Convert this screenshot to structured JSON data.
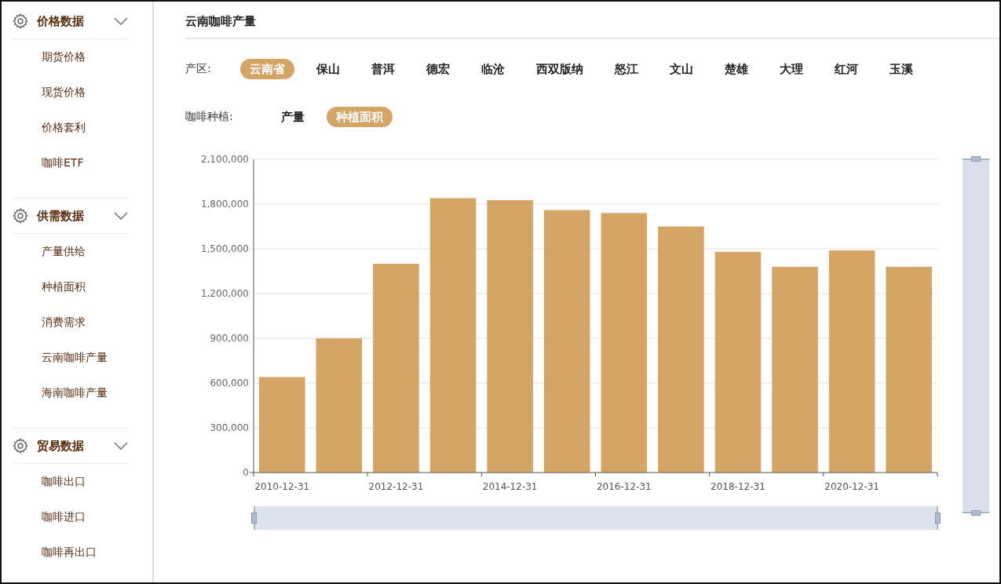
{
  "sidebar": {
    "sections": [
      {
        "title": "价格数据",
        "expanded": true,
        "items": [
          "期货价格",
          "现货价格",
          "价格套利",
          "咖啡ETF"
        ]
      },
      {
        "title": "供需数据",
        "expanded": true,
        "items": [
          "产量供给",
          "种植面积",
          "消费需求",
          "云南咖啡产量",
          "海南咖啡产量"
        ]
      },
      {
        "title": "贸易数据",
        "expanded": true,
        "items": [
          "咖啡出口",
          "咖啡进口",
          "咖啡再出口"
        ]
      }
    ]
  },
  "main": {
    "title": "云南咖啡产量",
    "filters": [
      {
        "label": "产区:",
        "options": [
          {
            "text": "云南省",
            "selected": true
          },
          {
            "text": "保山",
            "selected": false
          },
          {
            "text": "普洱",
            "selected": false
          },
          {
            "text": "德宏",
            "selected": false
          },
          {
            "text": "临沧",
            "selected": false
          },
          {
            "text": "西双版纳",
            "selected": false
          },
          {
            "text": "怒江",
            "selected": false
          },
          {
            "text": "文山",
            "selected": false
          },
          {
            "text": "楚雄",
            "selected": false
          },
          {
            "text": "大理",
            "selected": false
          },
          {
            "text": "红河",
            "selected": false
          },
          {
            "text": "玉溪",
            "selected": false
          }
        ]
      },
      {
        "label": "咖啡种植:",
        "options": [
          {
            "text": "产量",
            "selected": false
          },
          {
            "text": "种植面积",
            "selected": true
          }
        ]
      }
    ],
    "chart_data": {
      "type": "bar",
      "grid": true,
      "categories": [
        "2010-12-31",
        null,
        "2012-12-31",
        null,
        "2014-12-31",
        null,
        "2016-12-31",
        null,
        "2018-12-31",
        null,
        "2020-12-31",
        null
      ],
      "series": [
        {
          "color": "#d4a565",
          "values": [
            640000,
            900000,
            1400000,
            1840000,
            1826000,
            1760000,
            1740000,
            1650000,
            1480000,
            1380000,
            1490000,
            1380000
          ]
        }
      ],
      "ylim": [
        0,
        2100000
      ],
      "yticks": [
        {
          "value": 0,
          "label": "0"
        },
        {
          "value": 300000,
          "label": "300,000"
        },
        {
          "value": 600000,
          "label": "600,000"
        },
        {
          "value": 900000,
          "label": "900,000"
        },
        {
          "value": 1200000,
          "label": "1,200,000"
        },
        {
          "value": 1500000,
          "label": "1,500,000"
        },
        {
          "value": 1800000,
          "label": "1,800,000"
        },
        {
          "value": 2100000,
          "label": "2,100,000"
        }
      ]
    },
    "zoom_x": {
      "level": 1
    },
    "zoom_y": {
      "level": 1
    }
  }
}
